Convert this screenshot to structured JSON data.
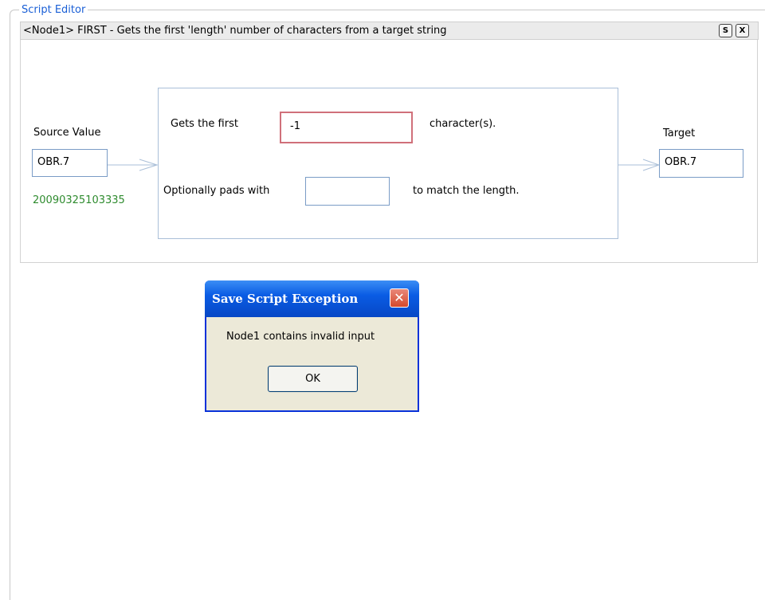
{
  "panel": {
    "legend": "Script Editor",
    "header": "<Node1> FIRST - Gets the first 'length' number of characters from a target string",
    "buttons": {
      "s": "S",
      "x": "X"
    }
  },
  "node": {
    "source_label": "Source Value",
    "source_value": "OBR.7",
    "source_preview": "20090325103335",
    "gets_first_label": "Gets the first",
    "length_value": "-1",
    "characters_label": "character(s).",
    "pads_label": "Optionally pads with",
    "pad_value": "",
    "match_label": "to match the length.",
    "target_label": "Target",
    "target_value": "OBR.7"
  },
  "dialog": {
    "title": "Save Script Exception",
    "message": "Node1 contains invalid input",
    "ok_label": "OK",
    "close_icon": "close-icon"
  },
  "colors": {
    "legend": "#1a5fd6",
    "preview": "#2e8b2e",
    "error_border": "#d0707a",
    "dialog_title": "#0a5ce4"
  }
}
